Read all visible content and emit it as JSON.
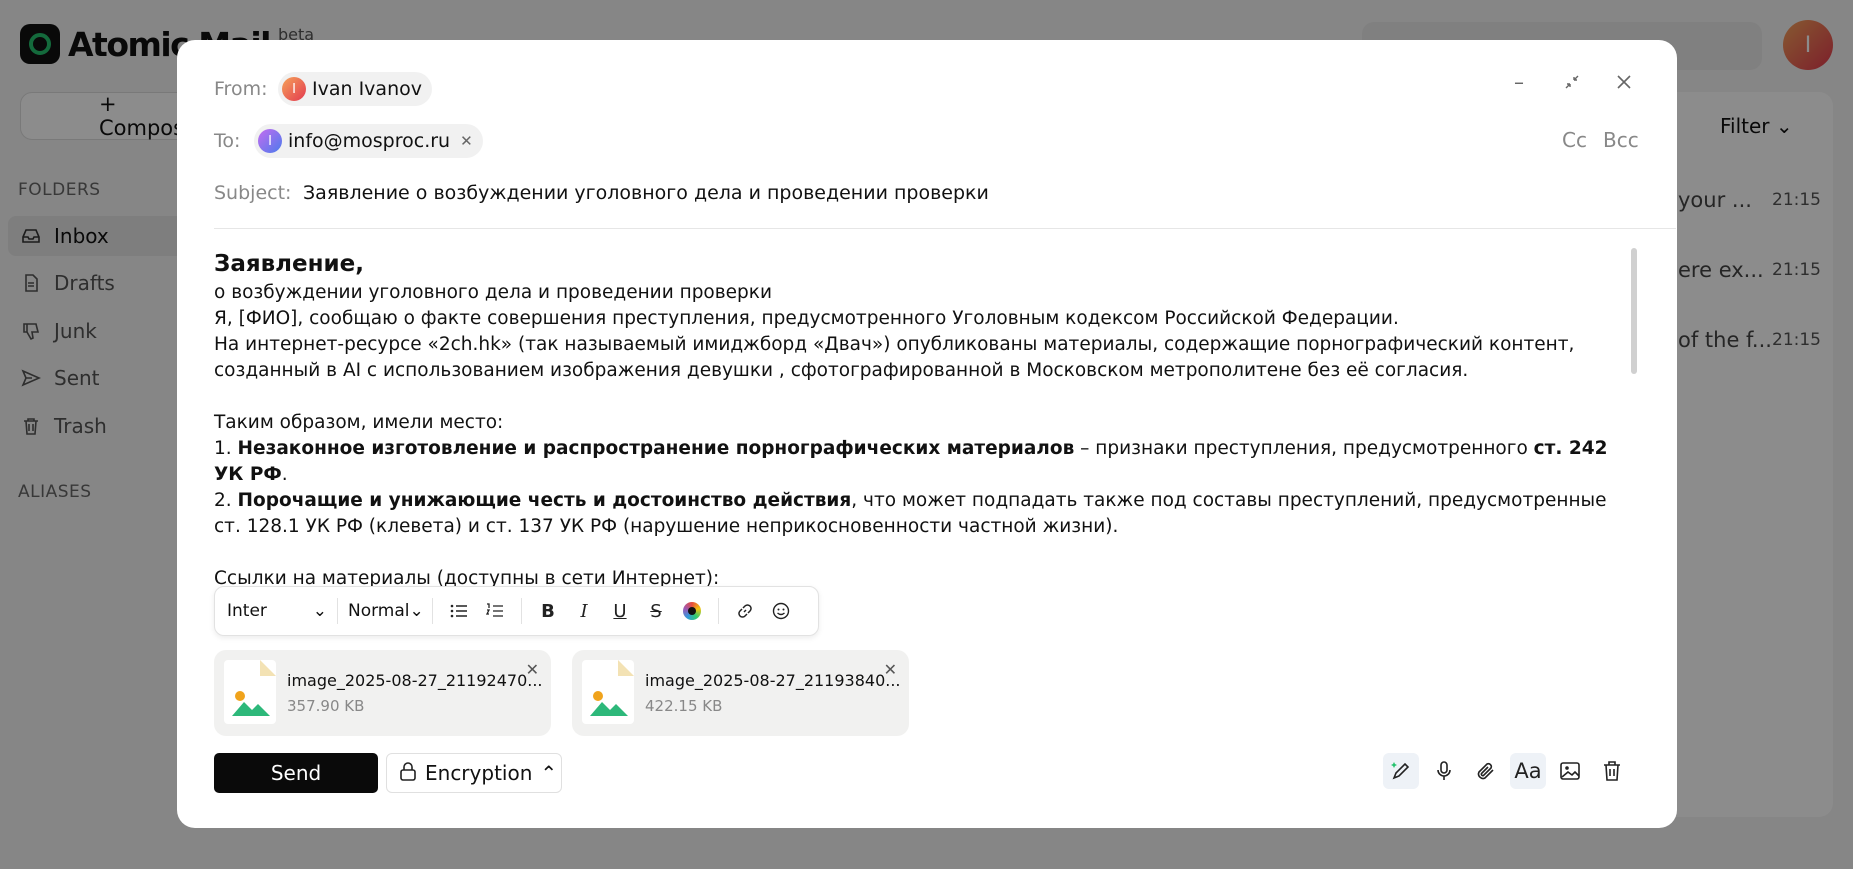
{
  "app": {
    "name": "Atomic Mail",
    "beta": "beta",
    "compose_label": "+ Compose",
    "folders_heading": "FOLDERS",
    "aliases_heading": "ALIASES",
    "folders": [
      {
        "label": "Inbox",
        "icon": "inbox-icon"
      },
      {
        "label": "Drafts",
        "icon": "file-icon"
      },
      {
        "label": "Junk",
        "icon": "thumbs-down-icon"
      },
      {
        "label": "Sent",
        "icon": "send-icon"
      },
      {
        "label": "Trash",
        "icon": "trash-icon"
      }
    ],
    "user_initial": "I",
    "filter_label": "Filter",
    "messages": [
      {
        "snippet": "your ...",
        "time": "21:15"
      },
      {
        "snippet": "ere ex...",
        "time": "21:15"
      },
      {
        "snippet": "of the f...",
        "time": "21:15"
      }
    ]
  },
  "compose": {
    "from_label": "From:",
    "from_name": "Ivan Ivanov",
    "from_initial": "I",
    "to_label": "To:",
    "to_address": "info@mosproc.ru",
    "to_initial": "I",
    "cc_label": "Cc",
    "bcc_label": "Bcc",
    "subject_label": "Subject:",
    "subject": "Заявление о возбуждении уголовного дела и проведении проверки",
    "body": {
      "title": "Заявление,",
      "line1": "о возбуждении уголовного дела и проведении проверки",
      "line2": "Я, [ФИО], сообщаю о факте совершения преступления, предусмотренного Уголовным кодексом Российской Федерации.",
      "line3": "На интернет-ресурсе «2ch.hk» (так называемый имиджборд «Двач») опубликованы материалы, содержащие порнографический контент, созданный в AI с использованием изображения девушки , сфотографированной в Московском метрополитене без её согласия.",
      "line4": "Таким образом, имели место:",
      "item1_num": "1.",
      "item1_bold": "Незаконное изготовление и распространение порнографических материалов",
      "item1_text": " – признаки преступления, предусмотренного ",
      "item1_ref": "ст. 242 УК РФ",
      "item1_end": ".",
      "item2_num": "2.",
      "item2_bold": "Порочащие и унижающие честь и достоинство действия",
      "item2_text": ", что может подпадать также под составы преступлений, предусмотренные ст. 128.1 УК РФ (клевета) и ст. 137 УК РФ (нарушение неприкосновенности частной жизни).",
      "line5": "Ссылки на материалы (доступны в сети Интернет):"
    },
    "toolbar": {
      "font": "Inter",
      "size": "Normal"
    },
    "attachments": [
      {
        "name": "image_2025-08-27_21192470...",
        "size": "357.90 KB"
      },
      {
        "name": "image_2025-08-27_21193840...",
        "size": "422.15 KB"
      }
    ],
    "send_label": "Send",
    "encryption_label": "Encryption",
    "aa_label": "Aa"
  },
  "colors": {
    "accent_green": "#25c26e",
    "send_bg": "#0a0a0a"
  }
}
